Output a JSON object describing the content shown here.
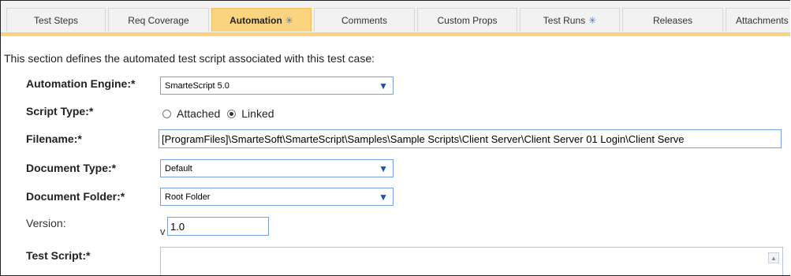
{
  "tabs": [
    {
      "label": "Test Steps",
      "starred": false,
      "active": false
    },
    {
      "label": "Req Coverage",
      "starred": false,
      "active": false
    },
    {
      "label": "Automation",
      "starred": true,
      "active": true
    },
    {
      "label": "Comments",
      "starred": false,
      "active": false
    },
    {
      "label": "Custom Props",
      "starred": false,
      "active": false
    },
    {
      "label": "Test Runs",
      "starred": true,
      "active": false
    },
    {
      "label": "Releases",
      "starred": false,
      "active": false
    },
    {
      "label": "Attachments",
      "starred": false,
      "active": false
    }
  ],
  "star_glyph": "✳",
  "intro": "This section defines the automated test script associated with this test case:",
  "form": {
    "engine_label": "Automation Engine:*",
    "engine_value": "SmarteScript 5.0",
    "script_type_label": "Script Type:*",
    "script_type_options": [
      "Attached",
      "Linked"
    ],
    "script_type_selected": "Linked",
    "filename_label": "Filename:*",
    "filename_value": "[ProgramFiles]\\SmarteSoft\\SmarteScript\\Samples\\Sample Scripts\\Client Server\\Client Server 01 Login\\Client Serve",
    "doc_type_label": "Document Type:*",
    "doc_type_value": "Default",
    "doc_folder_label": "Document Folder:*",
    "doc_folder_value": "Root Folder",
    "version_label": "Version:",
    "version_prefix": "v",
    "version_value": "1.0",
    "test_script_label": "Test Script:*"
  },
  "colors": {
    "active_tab": "#fbd47f",
    "star": "#3b7fd0",
    "input_border": "#7aa0d6",
    "dropdown_arrow": "#1a4fb5"
  }
}
